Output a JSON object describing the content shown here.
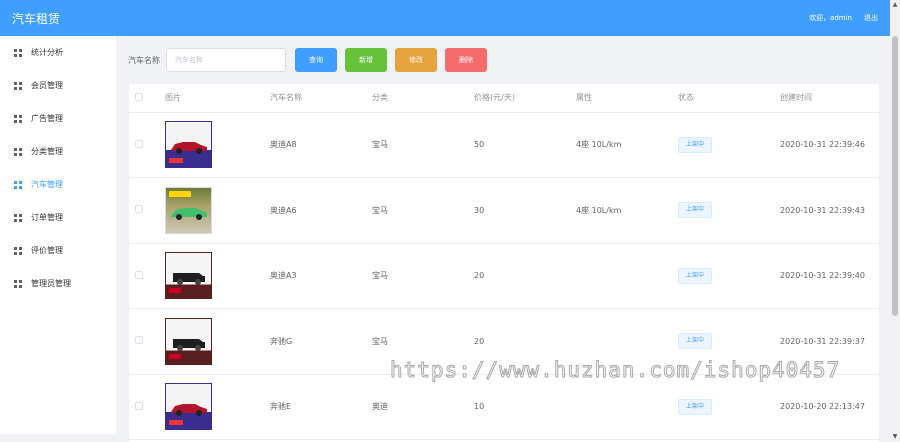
{
  "header": {
    "title": "汽车租赁",
    "welcome": "欢迎，admin",
    "logout": "退出"
  },
  "sidebar": {
    "items": [
      {
        "label": "统计分析"
      },
      {
        "label": "会员管理"
      },
      {
        "label": "广告管理"
      },
      {
        "label": "分类管理"
      },
      {
        "label": "汽车管理"
      },
      {
        "label": "订单管理"
      },
      {
        "label": "评价管理"
      },
      {
        "label": "管理员管理"
      }
    ],
    "active_index": 4
  },
  "toolbar": {
    "filter_label": "汽车名称",
    "filter_placeholder": "汽车名称",
    "filter_value": "",
    "search_label": "查询",
    "add_label": "新增",
    "edit_label": "修改",
    "delete_label": "删除"
  },
  "table": {
    "headers": {
      "image": "图片",
      "name": "汽车名称",
      "category": "分类",
      "price": "价格(元/天)",
      "attributes": "属性",
      "status": "状态",
      "created": "创建时间"
    },
    "rows": [
      {
        "name": "奥迪A8",
        "category": "宝马",
        "price": "50",
        "attributes": "4座 10L/km",
        "status": "上架中",
        "created": "2020-10-31 22:39:46"
      },
      {
        "name": "奥迪A6",
        "category": "宝马",
        "price": "30",
        "attributes": "4座 10L/km",
        "status": "上架中",
        "created": "2020-10-31 22:39:43"
      },
      {
        "name": "奥迪A3",
        "category": "宝马",
        "price": "20",
        "attributes": "",
        "status": "上架中",
        "created": "2020-10-31 22:39:40"
      },
      {
        "name": "奔驰G",
        "category": "宝马",
        "price": "20",
        "attributes": "",
        "status": "上架中",
        "created": "2020-10-31 22:39:37"
      },
      {
        "name": "奔驰E",
        "category": "奥迪",
        "price": "10",
        "attributes": "",
        "status": "上架中",
        "created": "2020-10-20 22:13:47"
      }
    ]
  },
  "watermark": "https://www.huzhan.com/ishop40457",
  "colors": {
    "primary": "#409eff",
    "success": "#67c23a",
    "warning": "#e6a23c",
    "danger": "#f56c6c"
  }
}
